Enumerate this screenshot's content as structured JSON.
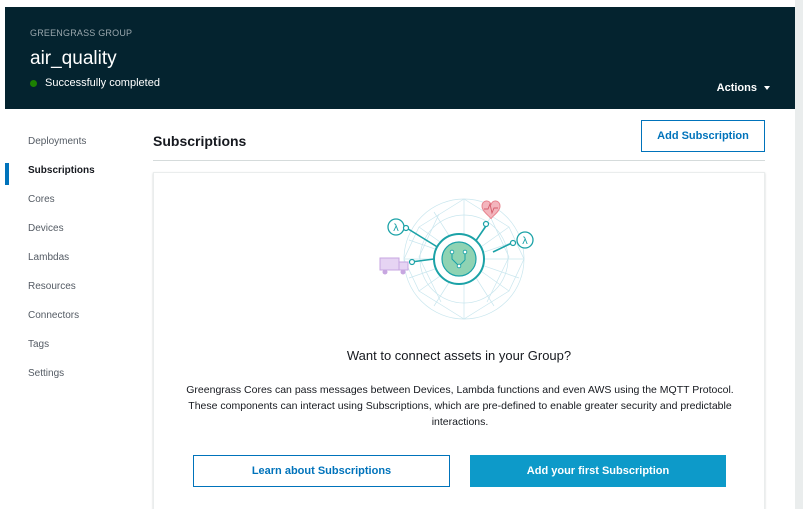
{
  "header": {
    "group_label": "GREENGRASS GROUP",
    "group_name": "air_quality",
    "status": "Successfully completed",
    "actions_label": "Actions"
  },
  "sidebar": {
    "items": [
      {
        "label": "Deployments"
      },
      {
        "label": "Subscriptions",
        "active": true
      },
      {
        "label": "Cores"
      },
      {
        "label": "Devices"
      },
      {
        "label": "Lambdas"
      },
      {
        "label": "Resources"
      },
      {
        "label": "Connectors"
      },
      {
        "label": "Tags"
      },
      {
        "label": "Settings"
      }
    ]
  },
  "main": {
    "title": "Subscriptions",
    "add_subscription_label": "Add Subscription",
    "empty_state": {
      "heading": "Want to connect assets in your Group?",
      "description": "Greengrass Cores can pass messages between Devices, Lambda functions and even AWS using the MQTT Protocol. These components can interact using Subscriptions, which are pre-defined to enable greater security and predictable interactions.",
      "learn_label": "Learn about Subscriptions",
      "add_first_label": "Add your first Subscription",
      "illustration_icons": [
        "lambda-icon",
        "heart-icon",
        "truck-icon",
        "core-hub-icon"
      ]
    }
  },
  "colors": {
    "header_bg": "#04232f",
    "accent": "#0073bb",
    "primary_button": "#0d9ac9",
    "status_ok": "#1d8102",
    "illustration_teal": "#1ba2a7",
    "heart": "#e8838e",
    "truck": "#c7a6e0"
  }
}
